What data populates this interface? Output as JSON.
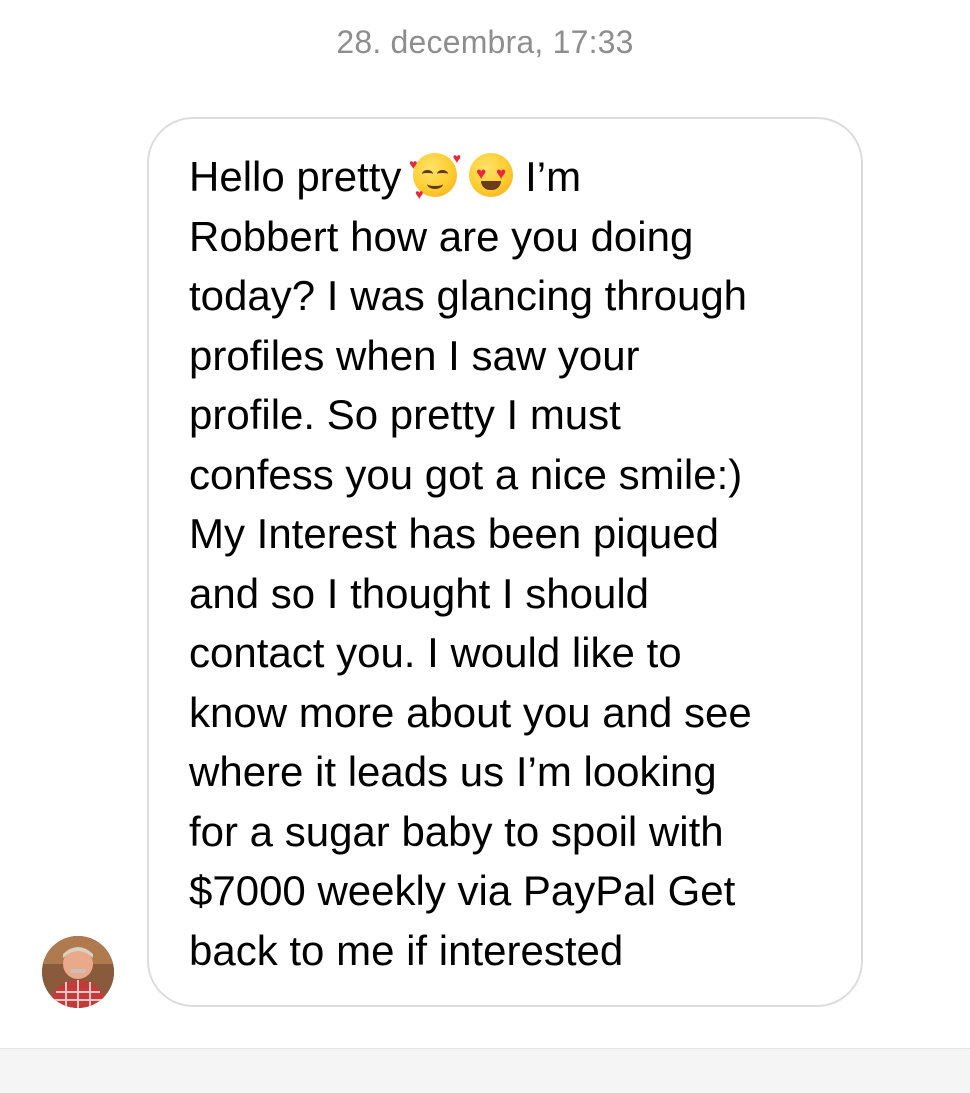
{
  "conversation": {
    "timestamp": "28. decembra, 17:33"
  },
  "message": {
    "first_words": "Hello pretty",
    "emojis": [
      "smiling-face-with-hearts-icon",
      "heart-eyes-icon"
    ],
    "body": "I’m\nRobbert how are you doing\ntoday? I was glancing through\nprofiles when I saw your\nprofile. So pretty I must\nconfess you got a nice smile:)\nMy Interest has been piqued\nand so I thought I should\ncontact you. I would like to\nknow more about you and see\nwhere it leads us I’m looking\nfor a sugar baby to spoil with\n$7000 weekly via PayPal Get\nback to me if interested"
  },
  "colors": {
    "timestamp": "#8e8e8e",
    "bubble_border": "#dcdcdc",
    "text": "#000000",
    "background": "#ffffff"
  }
}
